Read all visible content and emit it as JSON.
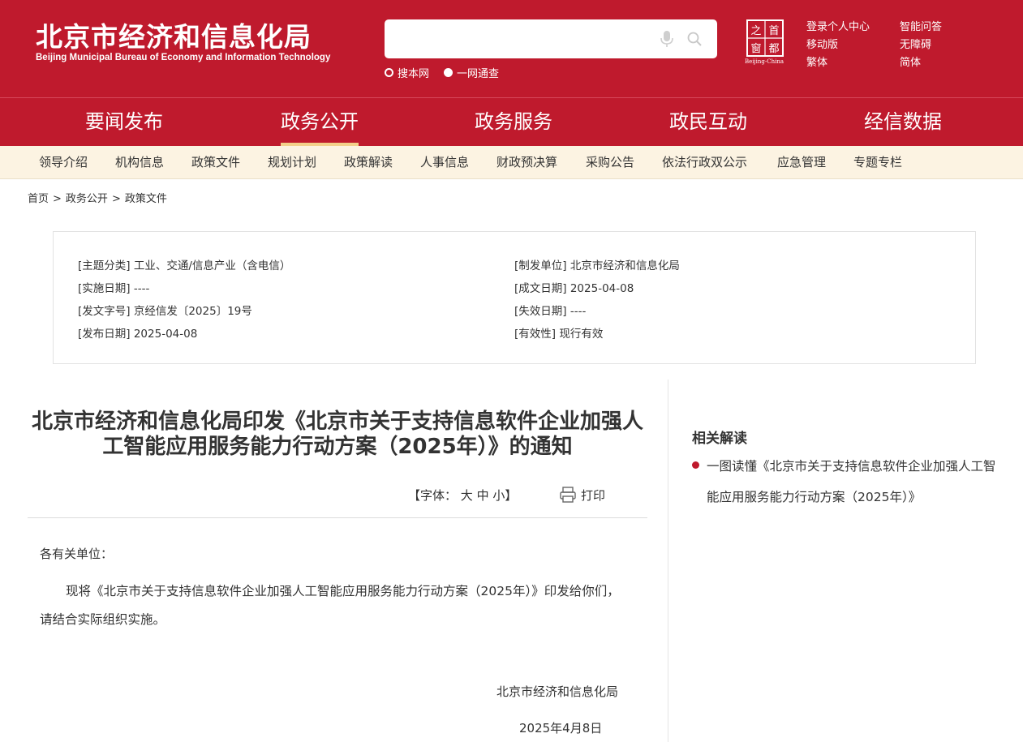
{
  "header": {
    "title": "北京市经济和信息化局",
    "subtitle": "Beijing Municipal Bureau of Economy and Information Technology",
    "search": {
      "placeholder": "",
      "scope_options": [
        "搜本网",
        "一网通查"
      ],
      "selected_scope": "搜本网"
    },
    "logo": {
      "chars": [
        "之",
        "首",
        "窗",
        "都"
      ],
      "caption": "Beijing-China"
    },
    "links": [
      "登录个人中心",
      "智能问答",
      "移动版",
      "无障碍",
      "繁体",
      "简体"
    ]
  },
  "main_nav": {
    "items": [
      "要闻发布",
      "政务公开",
      "政务服务",
      "政民互动",
      "经信数据"
    ],
    "active": "政务公开"
  },
  "sub_nav": {
    "items": [
      "领导介绍",
      "机构信息",
      "政策文件",
      "规划计划",
      "政策解读",
      "人事信息",
      "财政预决算",
      "采购公告",
      "依法行政双公示",
      "应急管理",
      "专题专栏"
    ]
  },
  "breadcrumb": {
    "items": [
      "首页",
      "政务公开",
      "政策文件"
    ],
    "separator": ">"
  },
  "meta": {
    "left": [
      {
        "label": "[主题分类]",
        "value": "工业、交通/信息产业（含电信）"
      },
      {
        "label": "[实施日期]",
        "value": "----"
      },
      {
        "label": "[发文字号]",
        "value": "京经信发〔2025〕19号"
      },
      {
        "label": "[发布日期]",
        "value": "2025-04-08"
      }
    ],
    "right": [
      {
        "label": "[制发单位]",
        "value": "北京市经济和信息化局"
      },
      {
        "label": "[成文日期]",
        "value": "2025-04-08"
      },
      {
        "label": "[失效日期]",
        "value": "----"
      },
      {
        "label": "[有效性]",
        "value": "现行有效"
      }
    ]
  },
  "article": {
    "title": "北京市经济和信息化局印发《北京市关于支持信息软件企业加强人工智能应用服务能力行动方案（2025年）》的通知",
    "font_label_open": "【字体：",
    "font_sizes": [
      "大",
      "中",
      "小"
    ],
    "font_label_close": "】",
    "print_label": "打印",
    "salutation": "各有关单位：",
    "body": "现将《北京市关于支持信息软件企业加强人工智能应用服务能力行动方案（2025年）》印发给你们，请结合实际组织实施。",
    "signature": "北京市经济和信息化局",
    "date": "2025年4月8日"
  },
  "related": {
    "title": "相关解读",
    "items": [
      "一图读懂《北京市关于支持信息软件企业加强人工智能应用服务能力行动方案（2025年）》"
    ]
  },
  "colors": {
    "brand_red": "#bf1a2d",
    "subnav_bg": "#fcf3e2",
    "active_underline": "#f3d08a"
  }
}
